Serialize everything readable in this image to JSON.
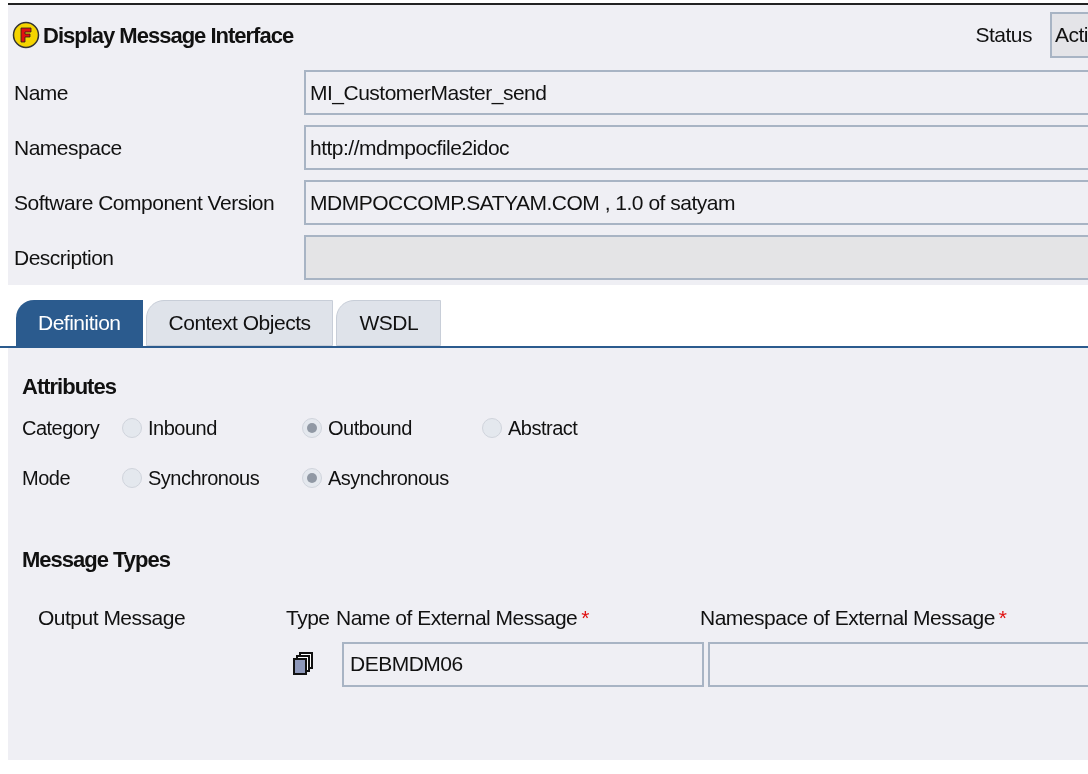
{
  "header": {
    "title": "Display Message Interface",
    "status_label": "Status",
    "status_value": "Acti"
  },
  "fields": [
    {
      "label": "Name",
      "value": "MI_CustomerMaster_send",
      "disabled": false
    },
    {
      "label": "Namespace",
      "value": "http://mdmpocfile2idoc",
      "disabled": false
    },
    {
      "label": "Software Component Version",
      "value": "MDMPOCCOMP.SATYAM.COM , 1.0 of satyam",
      "disabled": false
    },
    {
      "label": "Description",
      "disabled": true
    }
  ],
  "tabs": [
    {
      "label": "Definition",
      "selected": true
    },
    {
      "label": "Context Objects",
      "selected": false
    },
    {
      "label": "WSDL",
      "selected": false
    }
  ],
  "attributes": {
    "title": "Attributes",
    "groups": [
      {
        "label": "Category",
        "options": [
          {
            "label": "Inbound",
            "selected": false
          },
          {
            "label": "Outbound",
            "selected": true
          },
          {
            "label": "Abstract",
            "selected": false
          }
        ]
      },
      {
        "label": "Mode",
        "options": [
          {
            "label": "Synchronous",
            "selected": false
          },
          {
            "label": "Asynchronous",
            "selected": true
          }
        ]
      }
    ]
  },
  "message_types": {
    "title": "Message Types",
    "row_label": "Output Message",
    "columns": [
      {
        "label": "Type",
        "required": false
      },
      {
        "label": "Name of External Message",
        "required": true
      },
      {
        "label": "Namespace of External Message",
        "required": true
      }
    ],
    "required_mark": "*",
    "name_value": "DEBMDM06"
  }
}
